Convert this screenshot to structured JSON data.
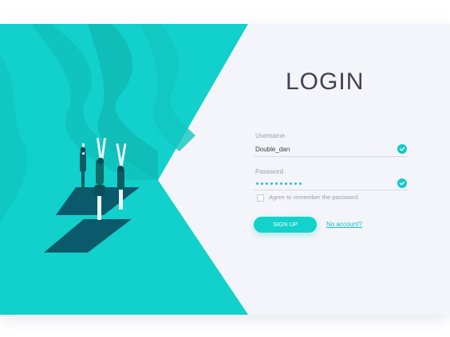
{
  "login": {
    "title": "LOGIN",
    "username_label": "Username",
    "username_value": "Double_dan",
    "password_label": "Password",
    "password_mask_count": 10,
    "remember_label": "Agree to remember the password.",
    "signup_label": "SIGN UP",
    "no_account_label": "No account?"
  },
  "colors": {
    "accent": "#13d2cc",
    "panel_bg": "#f4f5fa",
    "text_dark": "#3f4352",
    "muted": "#9aa0ad"
  },
  "icons": {
    "username_status": "check-icon",
    "password_status": "check-icon",
    "illustration": "yoga-illustration"
  }
}
